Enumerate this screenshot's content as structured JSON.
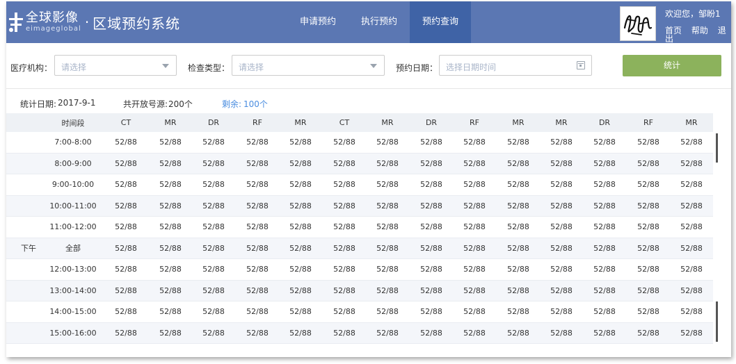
{
  "header": {
    "brand_cn": "全球影像",
    "brand_en": "eimageglobal",
    "separator": "·",
    "system_name": "区域预约系统",
    "nav": [
      "申请预约",
      "执行预约",
      "预约查询"
    ],
    "active_nav": "预约查询",
    "welcome": "欢迎您，邹盼1",
    "links": [
      "首页",
      "帮助",
      "退出"
    ],
    "colors": {
      "header_bg": "#5b77b3",
      "nav_active": "#3f63a6"
    }
  },
  "filters": {
    "institution_label": "医疗机构：",
    "institution_placeholder": "请选择",
    "exam_type_label": "检查类型：",
    "exam_type_placeholder": "请选择",
    "date_label": "预约日期：",
    "date_placeholder": "选择日期时间",
    "stat_button": "统计",
    "colors": {
      "stat_button": "#8cb25c"
    }
  },
  "summary": {
    "date_label": "统计日期:",
    "date_value": "2017-9-1",
    "total_label": "共开放号源:",
    "total_value": "200个",
    "remain_label": "剩余:",
    "remain_value": "100个"
  },
  "table": {
    "period_header": "",
    "slot_header": "时间段",
    "columns": [
      "CT",
      "MR",
      "DR",
      "RF",
      "MR",
      "CT",
      "MR",
      "DR",
      "RF",
      "MR",
      "MR",
      "DR",
      "RF",
      "MR"
    ],
    "rows": [
      {
        "period": "",
        "slot": "7:00-8:00",
        "values": [
          "52/88",
          "52/88",
          "52/88",
          "52/88",
          "52/88",
          "52/88",
          "52/88",
          "52/88",
          "52/88",
          "52/88",
          "52/88",
          "52/88",
          "52/88",
          "52/88"
        ]
      },
      {
        "period": "",
        "slot": "8:00-9:00",
        "values": [
          "52/88",
          "52/88",
          "52/88",
          "52/88",
          "52/88",
          "52/88",
          "52/88",
          "52/88",
          "52/88",
          "52/88",
          "52/88",
          "52/88",
          "52/88",
          "52/88"
        ]
      },
      {
        "period": "",
        "slot": "9:00-10:00",
        "values": [
          "52/88",
          "52/88",
          "52/88",
          "52/88",
          "52/88",
          "52/88",
          "52/88",
          "52/88",
          "52/88",
          "52/88",
          "52/88",
          "52/88",
          "52/88",
          "52/88"
        ]
      },
      {
        "period": "",
        "slot": "10:00-11:00",
        "values": [
          "52/88",
          "52/88",
          "52/88",
          "52/88",
          "52/88",
          "52/88",
          "52/88",
          "52/88",
          "52/88",
          "52/88",
          "52/88",
          "52/88",
          "52/88",
          "52/88"
        ]
      },
      {
        "period": "",
        "slot": "11:00-12:00",
        "values": [
          "52/88",
          "52/88",
          "52/88",
          "52/88",
          "52/88",
          "52/88",
          "52/88",
          "52/88",
          "52/88",
          "52/88",
          "52/88",
          "52/88",
          "52/88",
          "52/88"
        ]
      },
      {
        "period": "下午",
        "slot": "全部",
        "values": [
          "52/88",
          "52/88",
          "52/88",
          "52/88",
          "52/88",
          "52/88",
          "52/88",
          "52/88",
          "52/88",
          "52/88",
          "52/88",
          "52/88",
          "52/88",
          "52/88"
        ]
      },
      {
        "period": "",
        "slot": "12:00-13:00",
        "values": [
          "52/88",
          "52/88",
          "52/88",
          "52/88",
          "52/88",
          "52/88",
          "52/88",
          "52/88",
          "52/88",
          "52/88",
          "52/88",
          "52/88",
          "52/88",
          "52/88"
        ]
      },
      {
        "period": "",
        "slot": "13:00-14:00",
        "values": [
          "52/88",
          "52/88",
          "52/88",
          "52/88",
          "52/88",
          "52/88",
          "52/88",
          "52/88",
          "52/88",
          "52/88",
          "52/88",
          "52/88",
          "52/88",
          "52/88"
        ]
      },
      {
        "period": "",
        "slot": "14:00-15:00",
        "values": [
          "52/88",
          "52/88",
          "52/88",
          "52/88",
          "52/88",
          "52/88",
          "52/88",
          "52/88",
          "52/88",
          "52/88",
          "52/88",
          "52/88",
          "52/88",
          "52/88"
        ]
      },
      {
        "period": "",
        "slot": "15:00-16:00",
        "values": [
          "52/88",
          "52/88",
          "52/88",
          "52/88",
          "52/88",
          "52/88",
          "52/88",
          "52/88",
          "52/88",
          "52/88",
          "52/88",
          "52/88",
          "52/88",
          "52/88"
        ]
      }
    ]
  },
  "icons": [
    "logo-mark-icon",
    "dropdown-caret-icon",
    "calendar-icon"
  ]
}
